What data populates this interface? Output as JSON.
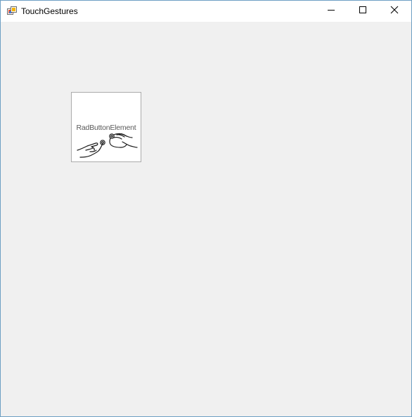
{
  "window": {
    "title": "TouchGestures",
    "app_icon": "winforms-app-icon",
    "controls": {
      "minimize_icon": "minimize-icon",
      "maximize_icon": "maximize-icon",
      "close_icon": "close-icon"
    }
  },
  "client": {
    "background": "#f0f0f0",
    "rad_button": {
      "label": "RadButtonElement",
      "icon": "touch-gestures-hands-icon"
    }
  }
}
